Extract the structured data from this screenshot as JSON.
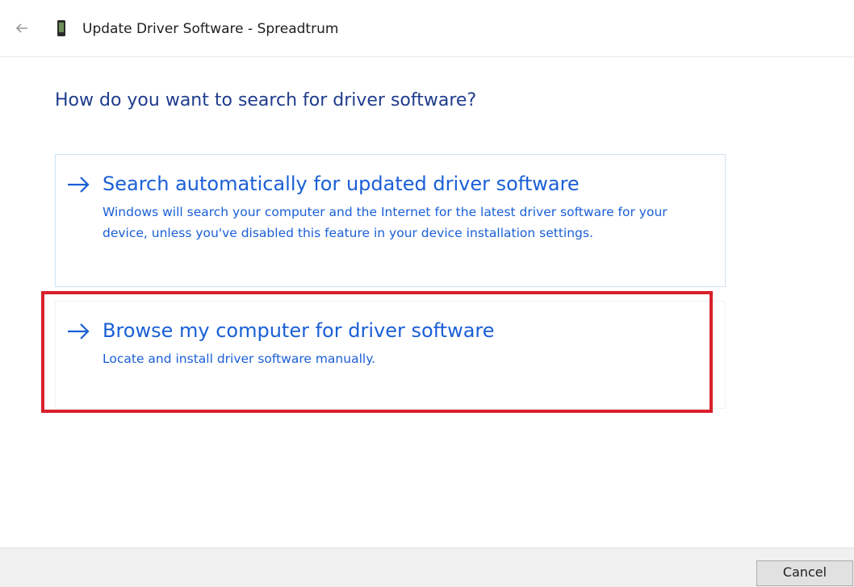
{
  "window": {
    "title": "Update Driver Software - Spreadtrum",
    "back_icon": "back-arrow-icon",
    "device_icon": "device-icon"
  },
  "main": {
    "heading": "How do you want to search for driver software?",
    "options": [
      {
        "title": "Search automatically for updated driver software",
        "description": "Windows will search your computer and the Internet for the latest driver software for your device, unless you've disabled this feature in your device installation settings.",
        "icon": "arrow-right-icon"
      },
      {
        "title": "Browse my computer for driver software",
        "description": "Locate and install driver software manually.",
        "icon": "arrow-right-icon",
        "highlighted": true
      }
    ]
  },
  "footer": {
    "cancel_label": "Cancel"
  },
  "colors": {
    "heading": "#1e3c8c",
    "link": "#1a5fd6",
    "highlight": "#d8202b",
    "footer_bg": "#f0f0f0"
  }
}
